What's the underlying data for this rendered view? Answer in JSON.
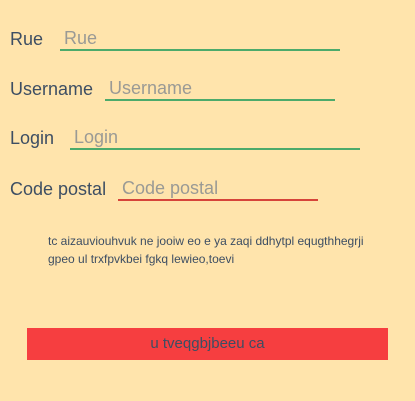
{
  "form": {
    "rue": {
      "label": "Rue",
      "placeholder": "Rue",
      "value": ""
    },
    "username": {
      "label": "Username",
      "placeholder": "Username",
      "value": ""
    },
    "login": {
      "label": "Login",
      "placeholder": "Login",
      "value": ""
    },
    "code_postal": {
      "label": "Code postal",
      "placeholder": "Code postal",
      "value": ""
    }
  },
  "message": "tc aizauviouhvuk ne jooiw eo e ya zaqi ddhytpl equgthhegrji gpeo ul trxfpvkbei fgkq lewieo,toevi",
  "submit_label": "u tveqgbjbeeu ca",
  "colors": {
    "background": "#ffe4ac",
    "text": "#3d4e63",
    "valid_underline": "#4caa6b",
    "invalid_underline": "#d6443a",
    "button": "#f63e40"
  }
}
